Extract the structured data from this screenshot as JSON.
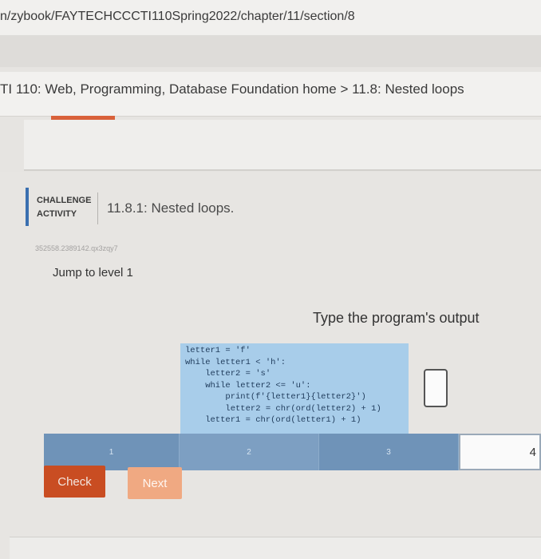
{
  "browser": {
    "url": "n/zybook/FAYTECHCCCTI110Spring2022/chapter/11/section/8"
  },
  "breadcrumb": {
    "course_link": "TI 110: Web, Programming, Database Foundation home",
    "separator": ">",
    "section": "11.8: Nested loops"
  },
  "challenge": {
    "label_line1": "CHALLENGE",
    "label_line2": "ACTIVITY",
    "title": "11.8.1: Nested loops.",
    "activity_id": "352558.2389142.qx3zqy7",
    "jump_label": "Jump to level 1",
    "instructions": "Type the program's output",
    "code": [
      "letter1 = 'f'",
      "while letter1 < 'h':",
      "    letter2 = 's'",
      "    while letter2 <= 'u':",
      "        print(f'{letter1}{letter2}')",
      "        letter2 = chr(ord(letter2) + 1)",
      "    letter1 = chr(ord(letter1) + 1)"
    ],
    "answer_value": ""
  },
  "levels": [
    "1",
    "2",
    "3",
    "4"
  ],
  "buttons": {
    "check": "Check",
    "next": "Next"
  },
  "colors": {
    "accent": "#d9613a",
    "level_bar": "#6f93b8",
    "code_bg": "#a8cdea",
    "check_button": "#c94d22",
    "next_button": "#f0a982"
  }
}
